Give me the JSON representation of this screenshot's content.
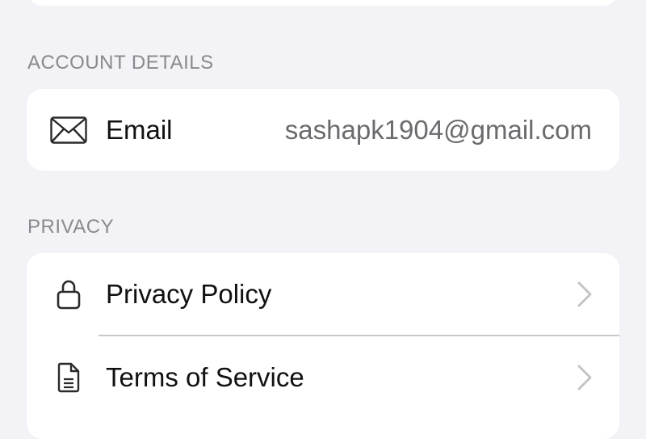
{
  "sections": {
    "account_details": {
      "header": "ACCOUNT DETAILS",
      "email": {
        "label": "Email",
        "value": "sashapk1904@gmail.com",
        "icon": "envelope-icon"
      }
    },
    "privacy": {
      "header": "PRIVACY",
      "items": [
        {
          "label": "Privacy Policy",
          "icon": "lock-icon"
        },
        {
          "label": "Terms of Service",
          "icon": "document-icon"
        }
      ]
    }
  },
  "colors": {
    "background": "#f2f2f7",
    "card": "#ffffff",
    "header_text": "#8a8a8e",
    "value_text": "#6b6b6f",
    "chevron": "#c4c4c7"
  }
}
